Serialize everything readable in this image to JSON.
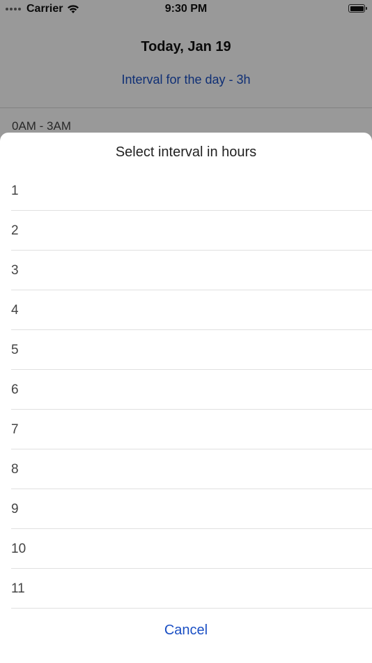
{
  "status_bar": {
    "carrier": "Carrier",
    "time": "9:30 PM",
    "wifi_icon": "wifi-icon",
    "battery_icon": "battery-icon"
  },
  "header": {
    "title": "Today, Jan 19",
    "interval_link": "Interval for the day - 3h"
  },
  "background_list": {
    "first_row": "0AM - 3AM"
  },
  "sheet": {
    "title": "Select interval in hours",
    "options": [
      "1",
      "2",
      "3",
      "4",
      "5",
      "6",
      "7",
      "8",
      "9",
      "10",
      "11"
    ],
    "cancel_label": "Cancel"
  },
  "colors": {
    "accent": "#1a4fc4",
    "overlay": "rgba(0,0,0,0.40)"
  }
}
